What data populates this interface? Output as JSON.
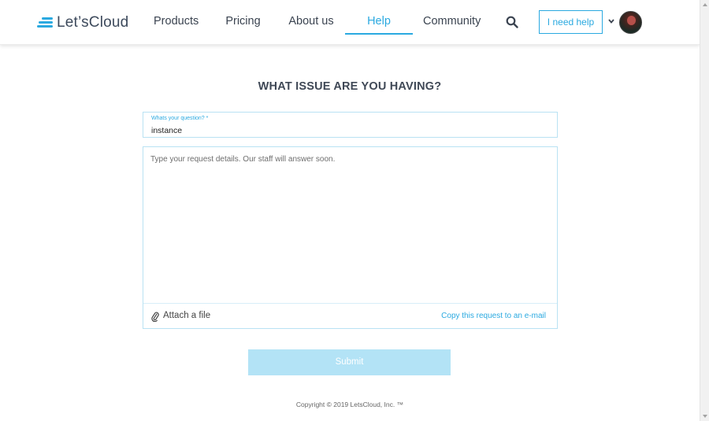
{
  "brand": {
    "name": "Let's Cloud",
    "logo_text": "Let’sCloud",
    "accent": "#2aa9e0"
  },
  "nav": {
    "items": [
      {
        "label": "Products"
      },
      {
        "label": "Pricing"
      },
      {
        "label": "About us"
      },
      {
        "label": "Help",
        "active": true
      },
      {
        "label": "Community"
      }
    ],
    "help_button": "I need help",
    "icons": [
      "search-icon",
      "chevron-down-icon",
      "avatar"
    ]
  },
  "main": {
    "title": "WHAT ISSUE ARE YOU HAVING?",
    "question": {
      "label": "Whats your question? *",
      "value": "instance"
    },
    "details": {
      "placeholder": "Type your request details. Our staff will answer soon.",
      "value": ""
    },
    "attach_label": "Attach a file",
    "copy_link": "Copy this request to an e-mail",
    "submit_label": "Submit"
  },
  "footer": {
    "copyright": "Copyright © 2019 LetsCloud, Inc. ™"
  }
}
